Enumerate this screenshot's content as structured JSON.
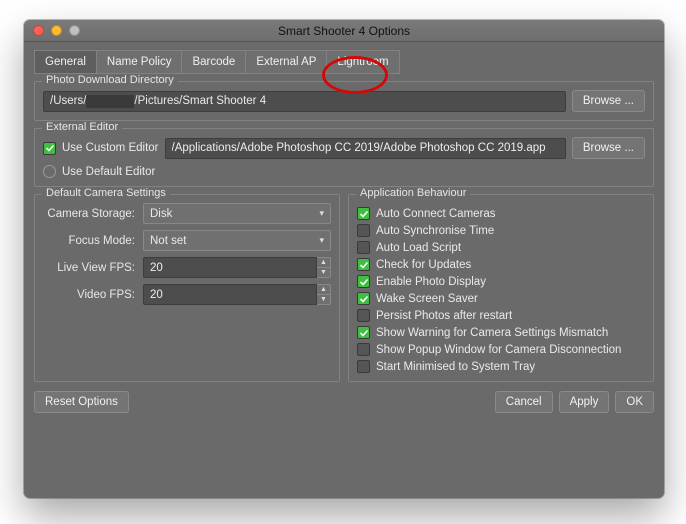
{
  "window": {
    "title": "Smart Shooter 4 Options"
  },
  "tabs": [
    "General",
    "Name Policy",
    "Barcode",
    "External AP",
    "Lightroom"
  ],
  "download": {
    "legend": "Photo Download Directory",
    "prefix": "/Users/",
    "suffix": "/Pictures/Smart Shooter 4",
    "browse": "Browse ..."
  },
  "editor": {
    "legend": "External Editor",
    "use_custom": "Use Custom Editor",
    "custom_path": "/Applications/Adobe Photoshop CC 2019/Adobe Photoshop CC 2019.app",
    "use_default": "Use Default Editor",
    "browse": "Browse ..."
  },
  "camera": {
    "legend": "Default Camera Settings",
    "rows": {
      "storage_label": "Camera Storage:",
      "storage_value": "Disk",
      "focus_label": "Focus Mode:",
      "focus_value": "Not set",
      "lvfps_label": "Live View FPS:",
      "lvfps_value": "20",
      "vfps_label": "Video FPS:",
      "vfps_value": "20"
    }
  },
  "behaviour": {
    "legend": "Application Behaviour",
    "items": [
      {
        "label": "Auto Connect Cameras",
        "on": true
      },
      {
        "label": "Auto Synchronise Time",
        "on": false
      },
      {
        "label": "Auto Load Script",
        "on": false
      },
      {
        "label": "Check for Updates",
        "on": true
      },
      {
        "label": "Enable Photo Display",
        "on": true
      },
      {
        "label": "Wake Screen Saver",
        "on": true
      },
      {
        "label": "Persist Photos after restart",
        "on": false
      },
      {
        "label": "Show Warning for Camera Settings Mismatch",
        "on": true
      },
      {
        "label": "Show Popup Window for Camera Disconnection",
        "on": false
      },
      {
        "label": "Start Minimised to System Tray",
        "on": false
      }
    ]
  },
  "footer": {
    "reset": "Reset Options",
    "cancel": "Cancel",
    "apply": "Apply",
    "ok": "OK"
  }
}
